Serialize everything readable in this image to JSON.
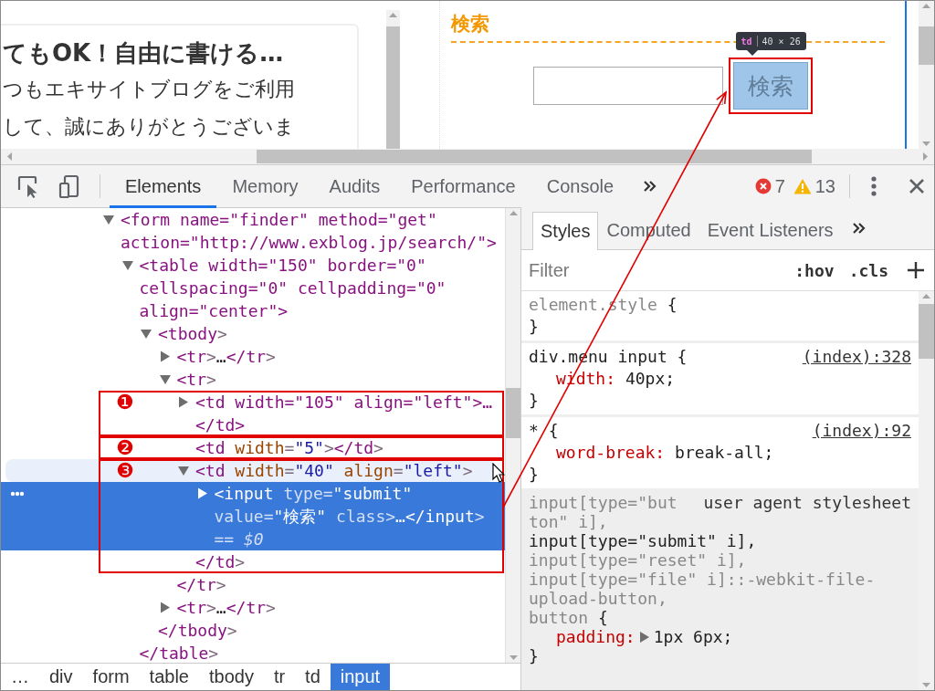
{
  "page": {
    "heading": "てもOK！自由に書ける…",
    "lines": [
      "つもエキサイトブログをご利用",
      "して、誠にありがとうございま"
    ],
    "search": {
      "title": "検索",
      "button": "検索",
      "highlighted": true,
      "tooltip": {
        "tag": "td",
        "size": "40 × 26"
      }
    }
  },
  "devtools": {
    "tabs": [
      {
        "label": "Elements",
        "selected": true
      },
      {
        "label": "Memory",
        "selected": false
      },
      {
        "label": "Audits",
        "selected": false
      },
      {
        "label": "Performance",
        "selected": false
      },
      {
        "label": "Console",
        "selected": false
      }
    ],
    "errors": "7",
    "warnings": "13"
  },
  "elements": {
    "tree": [
      {
        "text": "<form name=\"finder\" method=\"get\" action=\"http://www.exblog.jp/search/\">",
        "kind": "branch",
        "expanded": true,
        "selected": false,
        "hovered": false,
        "children": [
          {
            "text": "<table width=\"150\" border=\"0\" cellspacing=\"0\" cellpadding=\"0\" align=\"center\">",
            "kind": "branch",
            "expanded": true,
            "selected": false,
            "hovered": false,
            "close": "</table>",
            "children": [
              {
                "text": "<tbody>",
                "kind": "branch",
                "expanded": true,
                "selected": false,
                "hovered": false,
                "close": "</tbody>",
                "children": [
                  {
                    "text": "<tr>…</tr>",
                    "kind": "branch",
                    "expanded": false,
                    "selected": false,
                    "hovered": false
                  },
                  {
                    "text": "<tr>",
                    "kind": "branch",
                    "expanded": true,
                    "selected": false,
                    "hovered": false,
                    "close": "</tr>",
                    "children": [
                      {
                        "text": "<td width=\"105\" align=\"left\">…</td>",
                        "kind": "branch",
                        "expanded": false,
                        "selected": false,
                        "hovered": false,
                        "marker": "❶"
                      },
                      {
                        "text": "<td width=\"5\"></td>",
                        "kind": "leaf",
                        "selected": false,
                        "hovered": false,
                        "marker": "❷"
                      },
                      {
                        "text": "<td width=\"40\" align=\"left\">",
                        "kind": "branch",
                        "expanded": true,
                        "selected": false,
                        "hovered": true,
                        "marker": "❸",
                        "close": "</td>",
                        "children": [
                          {
                            "text": "<input type=\"submit\" value=\"検索\" class>…</input>",
                            "kind": "branch",
                            "expanded": false,
                            "selected": true,
                            "hovered": false,
                            "suffix": "== $0"
                          }
                        ]
                      }
                    ]
                  },
                  {
                    "text": "<tr>…</tr>",
                    "kind": "branch",
                    "expanded": false,
                    "selected": false,
                    "hovered": false
                  }
                ]
              }
            ]
          }
        ]
      }
    ]
  },
  "breadcrumbs": [
    {
      "label": "…",
      "selected": false
    },
    {
      "label": "div",
      "selected": false
    },
    {
      "label": "form",
      "selected": false
    },
    {
      "label": "table",
      "selected": false
    },
    {
      "label": "tbody",
      "selected": false
    },
    {
      "label": "tr",
      "selected": false
    },
    {
      "label": "td",
      "selected": false
    },
    {
      "label": "input",
      "selected": true
    }
  ],
  "styles": {
    "tabs": [
      {
        "label": "Styles",
        "selected": true
      },
      {
        "label": "Computed",
        "selected": false
      },
      {
        "label": "Event Listeners",
        "selected": false
      }
    ],
    "filter": {
      "placeholder": "Filter"
    },
    "hov": ":hov",
    "cls": ".cls",
    "rules": [
      {
        "kind": "inline",
        "selectors": [
          {
            "text": "element.style",
            "matched": false
          }
        ],
        "open": "{",
        "close": "}"
      },
      {
        "kind": "author",
        "source": "(index):328",
        "selectors": [
          {
            "text": "div.menu input",
            "matched": true
          }
        ],
        "open": "{",
        "close": "}",
        "declarations": [
          {
            "property": "width:",
            "value": "40px;",
            "expandable": false
          }
        ]
      },
      {
        "kind": "author",
        "source": "(index):92",
        "selectors": [
          {
            "text": "*",
            "matched": true
          }
        ],
        "open": "{",
        "close": "}",
        "declarations": [
          {
            "property": "word-break:",
            "value": "break-all;",
            "expandable": false
          }
        ]
      },
      {
        "kind": "agent",
        "source": "user agent stylesheet",
        "selectors": [
          {
            "text": "input[type=\"button\" i],",
            "matched": false
          },
          {
            "text": "input[type=\"submit\" i],",
            "matched": true
          },
          {
            "text": "input[type=\"reset\" i],",
            "matched": false
          },
          {
            "text": "input[type=\"file\" i]::-webkit-file-upload-button,",
            "matched": false
          },
          {
            "text": "button",
            "matched": false
          }
        ],
        "open": "{",
        "close": "}",
        "declarations": [
          {
            "property": "padding:",
            "value": "1px 6px;",
            "expandable": true
          }
        ]
      }
    ]
  }
}
